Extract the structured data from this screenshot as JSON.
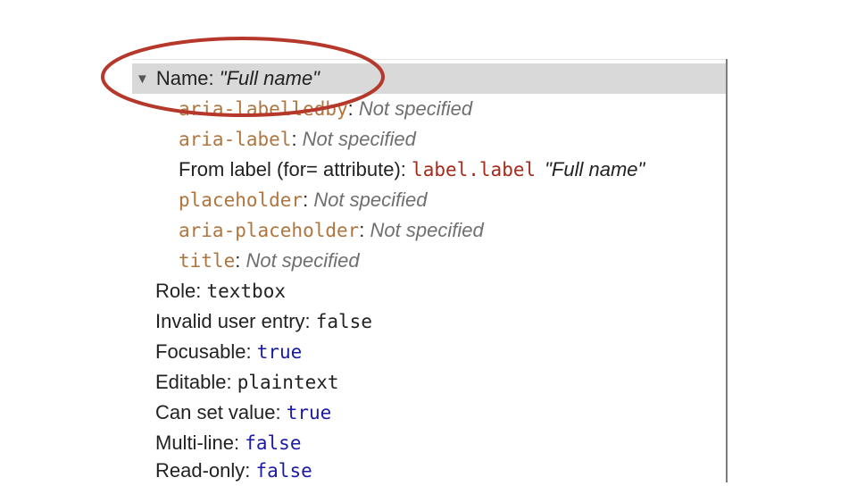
{
  "name_row": {
    "prefix": "Name: ",
    "value": "\"Full name\""
  },
  "sources": [
    {
      "attr": "aria-labelledby",
      "sep": ": ",
      "value": "Not specified"
    },
    {
      "attr": "aria-label",
      "sep": ": ",
      "value": "Not specified"
    },
    {
      "label_text": "From label (for= attribute): ",
      "selector": "label.label",
      "value": "\"Full name\""
    },
    {
      "attr": "placeholder",
      "sep": ": ",
      "value": "Not specified"
    },
    {
      "attr": "aria-placeholder",
      "sep": ": ",
      "value": "Not specified"
    },
    {
      "attr": "title",
      "sep": ": ",
      "value": "Not specified"
    }
  ],
  "properties": [
    {
      "label": "Role: ",
      "value": "textbox"
    },
    {
      "label": "Invalid user entry: ",
      "value": "false"
    },
    {
      "label": "Focusable: ",
      "value": "true"
    },
    {
      "label": "Editable: ",
      "value": "plaintext"
    },
    {
      "label": "Can set value: ",
      "value": "true"
    },
    {
      "label": "Multi-line: ",
      "value": "false"
    },
    {
      "label": "Read-only: ",
      "value": "false"
    }
  ],
  "colors": {
    "highlight_ellipse": "#b5382b",
    "attribute": "#b0753e",
    "keyword_true_false": "#1a1aa6",
    "selector": "#a52a1a"
  },
  "icons": {
    "expand_toggle": "triangle-down-icon"
  }
}
